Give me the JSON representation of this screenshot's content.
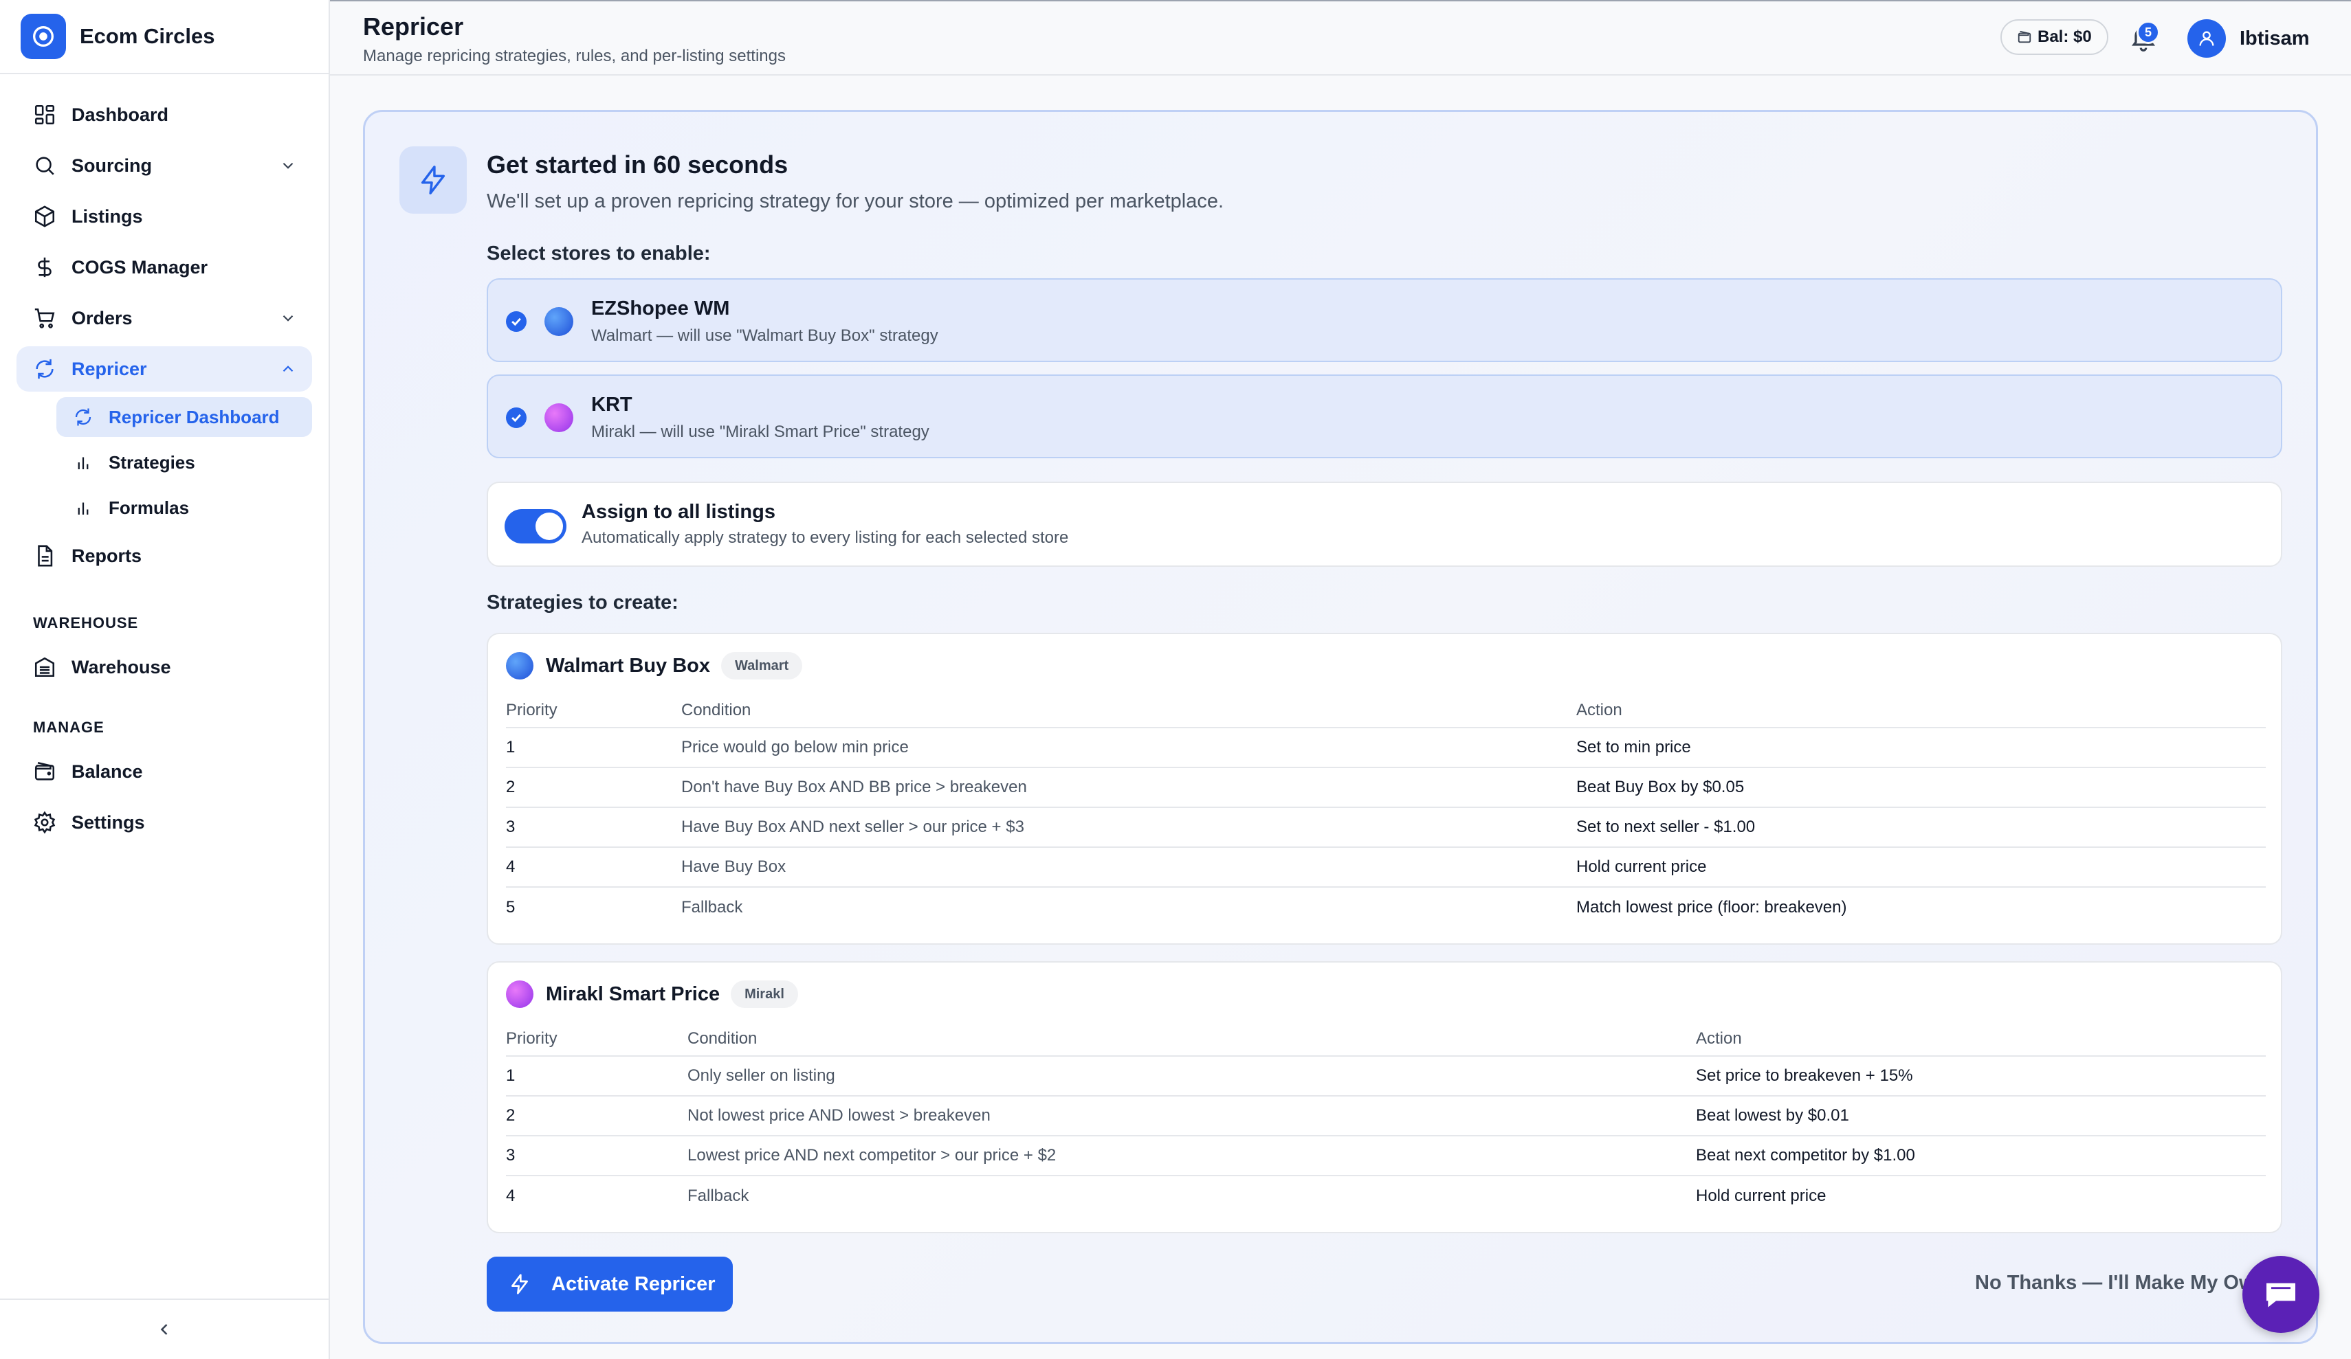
{
  "brand": {
    "name": "Ecom Circles"
  },
  "sidebar": {
    "items": [
      {
        "label": "Dashboard",
        "icon": "dashboard-icon"
      },
      {
        "label": "Sourcing",
        "icon": "search-icon"
      },
      {
        "label": "Listings",
        "icon": "box-icon"
      },
      {
        "label": "COGS Manager",
        "icon": "dollar-icon"
      },
      {
        "label": "Orders",
        "icon": "cart-icon"
      },
      {
        "label": "Repricer",
        "icon": "refresh-icon"
      },
      {
        "label": "Reports",
        "icon": "report-icon"
      }
    ],
    "subitems": [
      {
        "label": "Repricer Dashboard"
      },
      {
        "label": "Strategies"
      },
      {
        "label": "Formulas"
      }
    ],
    "warehouse_title": "WAREHOUSE",
    "warehouse_item": "Warehouse",
    "manage_title": "MANAGE",
    "manage_items": [
      {
        "label": "Balance"
      },
      {
        "label": "Settings"
      }
    ]
  },
  "header": {
    "title": "Repricer",
    "subtitle": "Manage repricing strategies, rules, and per-listing settings",
    "balance": "Bal: $0",
    "notifications": "5",
    "user": "Ibtisam"
  },
  "onboarding": {
    "title": "Get started in 60 seconds",
    "subtitle": "We'll set up a proven repricing strategy for your store — optimized per marketplace.",
    "select_label": "Select stores to enable:",
    "stores": [
      {
        "name": "EZShopee WM",
        "desc": "Walmart — will use \"Walmart Buy Box\" strategy",
        "color": "#2563eb",
        "checked": true
      },
      {
        "name": "KRT",
        "desc": "Mirakl — will use \"Mirakl Smart Price\" strategy",
        "color": "#a21caf",
        "checked": true
      }
    ],
    "assign": {
      "title": "Assign to all listings",
      "desc": "Automatically apply strategy to every listing for each selected store",
      "enabled": true
    },
    "strategies_label": "Strategies to create:",
    "strategies": [
      {
        "name": "Walmart Buy Box",
        "tag": "Walmart",
        "color": "#2563eb",
        "headers": [
          "Priority",
          "Condition",
          "Action"
        ],
        "rows": [
          {
            "priority": "1",
            "condition": "Price would go below min price",
            "action": "Set to min price"
          },
          {
            "priority": "2",
            "condition": "Don't have Buy Box AND BB price > breakeven",
            "action": "Beat Buy Box by $0.05"
          },
          {
            "priority": "3",
            "condition": "Have Buy Box AND next seller > our price + $3",
            "action": "Set to next seller - $1.00"
          },
          {
            "priority": "4",
            "condition": "Have Buy Box",
            "action": "Hold current price"
          },
          {
            "priority": "5",
            "condition": "Fallback",
            "action": "Match lowest price (floor: breakeven)"
          }
        ]
      },
      {
        "name": "Mirakl Smart Price",
        "tag": "Mirakl",
        "color": "#9333ea",
        "headers": [
          "Priority",
          "Condition",
          "Action"
        ],
        "rows": [
          {
            "priority": "1",
            "condition": "Only seller on listing",
            "action": "Set price to breakeven + 15%"
          },
          {
            "priority": "2",
            "condition": "Not lowest price AND lowest > breakeven",
            "action": "Beat lowest by $0.01"
          },
          {
            "priority": "3",
            "condition": "Lowest price AND next competitor > our price + $2",
            "action": "Beat next competitor by $1.00"
          },
          {
            "priority": "4",
            "condition": "Fallback",
            "action": "Hold current price"
          }
        ]
      }
    ],
    "activate_label": "Activate Repricer",
    "no_thanks_label": "No Thanks — I'll Make My Own"
  },
  "colors": {
    "accent": "#2563eb",
    "chat": "#5b21b6"
  }
}
